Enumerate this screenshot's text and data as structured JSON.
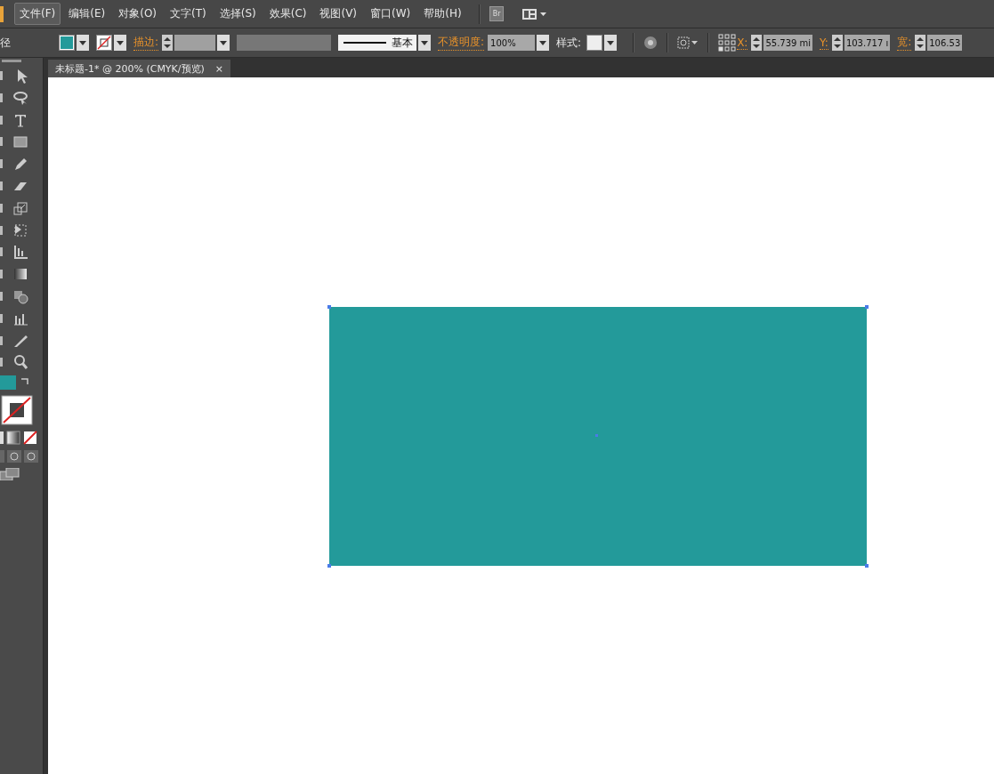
{
  "menu_bar": {
    "items": [
      {
        "label": "文件(F)",
        "selected": true
      },
      {
        "label": "编辑(E)",
        "selected": false
      },
      {
        "label": "对象(O)",
        "selected": false
      },
      {
        "label": "文字(T)",
        "selected": false
      },
      {
        "label": "选择(S)",
        "selected": false
      },
      {
        "label": "效果(C)",
        "selected": false
      },
      {
        "label": "视图(V)",
        "selected": false
      },
      {
        "label": "窗口(W)",
        "selected": false
      },
      {
        "label": "帮助(H)",
        "selected": false
      }
    ],
    "bridge_button": "Br"
  },
  "control_bar": {
    "selection_label": "径",
    "stroke_label": "描边:",
    "brush_label": "基本",
    "opacity_label": "不透明度:",
    "opacity_value": "100%",
    "style_label": "样式:",
    "x_label": "X:",
    "x_value": "55.739 mi",
    "y_label": "Y:",
    "y_value": "103.717 ı",
    "width_label": "宽:",
    "width_value": "106.53"
  },
  "document_tabs": [
    {
      "title": "未标题-1* @ 200% (CMYK/预览)",
      "close": "×",
      "selected": true
    }
  ]
}
